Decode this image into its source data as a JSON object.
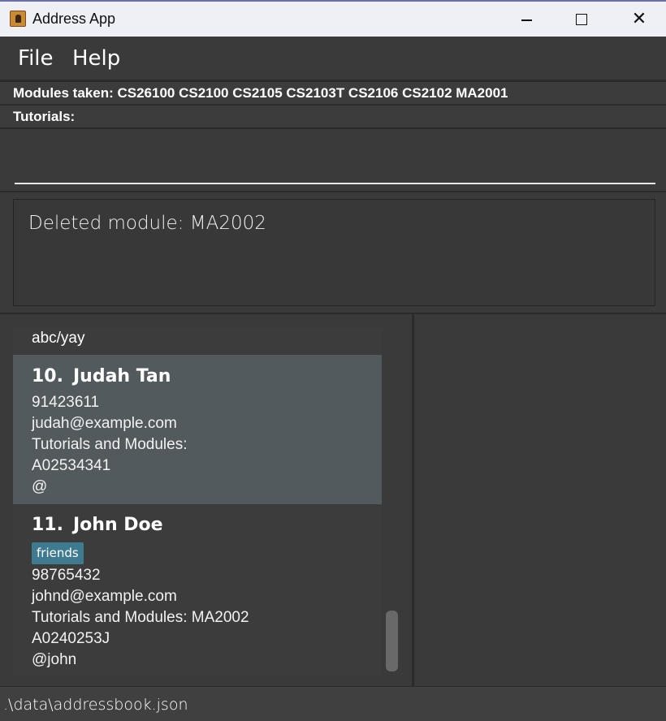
{
  "window": {
    "title": "Address App",
    "app_icon": "address-book-icon",
    "minimize_icon": "minimize-icon",
    "maximize_icon": "maximize-icon",
    "close_glyph": "✕"
  },
  "menu": {
    "file_label": "File",
    "help_label": "Help"
  },
  "info": {
    "modules_taken": "Modules taken: CS26100 CS2100 CS2105 CS2103T CS2106 CS2102 MA2001",
    "tutorials": "Tutorials:"
  },
  "command": {
    "value": "",
    "placeholder": ""
  },
  "result": {
    "text": "Deleted module: MA2002"
  },
  "person_list": {
    "partial_card": {
      "last_line": "abc/yay"
    },
    "cards": [
      {
        "index": "10.",
        "name": "Judah Tan",
        "tags": [],
        "phone": "91423611",
        "email": "judah@example.com",
        "tutorials_modules": "Tutorials and Modules:",
        "student_id": "A02534341",
        "telegram": "@",
        "selected": true
      },
      {
        "index": "11.",
        "name": "John Doe",
        "tags": [
          "friends"
        ],
        "phone": "98765432",
        "email": "johnd@example.com",
        "tutorials_modules": "Tutorials and Modules: MA2002",
        "student_id": "A0240253J",
        "telegram": "@john",
        "selected": false
      }
    ]
  },
  "status_bar": {
    "file_path": ".\\data\\addressbook.json"
  },
  "colors": {
    "background": "#3a3a3a",
    "selected_card": "#525a5e",
    "tag": "#3e7b91",
    "titlebar": "#eef0f6"
  }
}
